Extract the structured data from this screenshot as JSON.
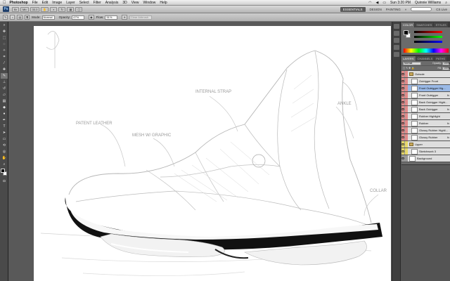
{
  "menubar": {
    "apple": "",
    "items": [
      "Photoshop",
      "File",
      "Edit",
      "Image",
      "Layer",
      "Select",
      "Filter",
      "Analysis",
      "3D",
      "View",
      "Window",
      "Help"
    ],
    "clock": "Sun 3:20 PM",
    "user": "Quinnie Williams"
  },
  "appbar": {
    "logo": "Ps",
    "zoom": "33.3",
    "workspaces": [
      "ESSENTIALS",
      "DESIGN",
      "PAINTING"
    ],
    "cs_live": "CS Live"
  },
  "optbar": {
    "mode_label": "Mode:",
    "mode_value": "Normal",
    "opacity_label": "Opacity:",
    "opacity_value": "47%",
    "flow_label": "Flow:",
    "flow_value": "51%",
    "airbrush": "Clear Airbrush"
  },
  "panels": {
    "color_tabs": [
      "COLOR",
      "SWATCHES",
      "STYLES"
    ],
    "layer_tabs": [
      "LAYERS",
      "CHANNELS",
      "PATHS"
    ],
    "blend_mode": "Normal",
    "opacity_label": "Opacity:",
    "opacity_value": "100%",
    "fill_label": "Fill:",
    "fill_value": "100%",
    "layers": [
      {
        "name": "Outsole",
        "type": "group",
        "color": "#e08a8a",
        "selected": false,
        "fx": false,
        "indent": false
      },
      {
        "name": "Outrigger Front",
        "type": "layer",
        "color": "#e08a8a",
        "selected": false,
        "fx": false,
        "indent": true
      },
      {
        "name": "Front Outrigger Hig...",
        "type": "layer",
        "color": "#e08a8a",
        "selected": true,
        "fx": false,
        "indent": true
      },
      {
        "name": "Front Outrigger",
        "type": "layer",
        "color": "#e08a8a",
        "selected": false,
        "fx": true,
        "indent": true
      },
      {
        "name": "Back Outrigger Hight...",
        "type": "layer",
        "color": "#e08a8a",
        "selected": false,
        "fx": false,
        "indent": true
      },
      {
        "name": "Back Outrigger",
        "type": "layer",
        "color": "#e08a8a",
        "selected": false,
        "fx": true,
        "indent": true
      },
      {
        "name": "Rubber Highlight",
        "type": "layer",
        "color": "#e08a8a",
        "selected": false,
        "fx": false,
        "indent": true
      },
      {
        "name": "Rubber",
        "type": "layer",
        "color": "#e08a8a",
        "selected": false,
        "fx": true,
        "indent": true
      },
      {
        "name": "Glossy Rubber Highli...",
        "type": "layer",
        "color": "#e08a8a",
        "selected": false,
        "fx": false,
        "indent": true
      },
      {
        "name": "Glossy Rubber",
        "type": "layer",
        "color": "#e08a8a",
        "selected": false,
        "fx": true,
        "indent": true
      },
      {
        "name": "Upper",
        "type": "group",
        "color": "#e6d86a",
        "selected": false,
        "fx": false,
        "indent": false
      },
      {
        "name": "Sketchwork 3",
        "type": "layer",
        "color": "#e6d86a",
        "selected": false,
        "fx": false,
        "indent": true
      },
      {
        "name": "Background",
        "type": "layer",
        "color": "#9a9a9a",
        "selected": false,
        "fx": false,
        "indent": false
      }
    ]
  },
  "sketch": {
    "annotations": [
      "INTERNAL STRAP",
      "PATENT LEATHER",
      "MESH W/ GRAPHIC",
      "ANKLE",
      "COLLAR"
    ],
    "colors": {
      "pencil": "#bdbdbd",
      "sole_black": "#111111",
      "sole_white": "#f4f4f4"
    }
  }
}
